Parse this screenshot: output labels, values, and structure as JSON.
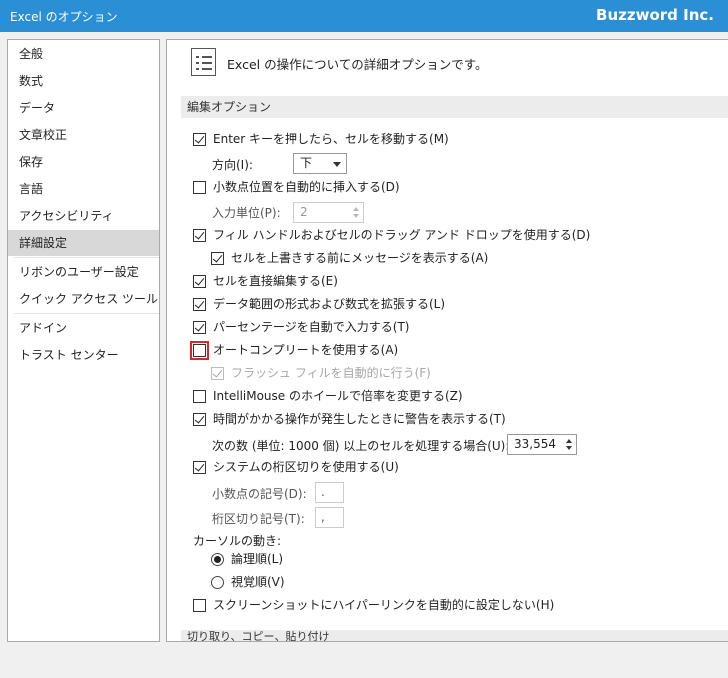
{
  "window": {
    "title": "Excel のオプション",
    "brand": "Buzzword Inc."
  },
  "sidebar": {
    "items": [
      {
        "label": "全般"
      },
      {
        "label": "数式"
      },
      {
        "label": "データ"
      },
      {
        "label": "文章校正"
      },
      {
        "label": "保存"
      },
      {
        "label": "言語"
      },
      {
        "label": "アクセシビリティ"
      },
      {
        "label": "詳細設定",
        "selected": true
      },
      {
        "label": "リボンのユーザー設定"
      },
      {
        "label": "クイック アクセス ツール バー"
      },
      {
        "label": "アドイン"
      },
      {
        "label": "トラスト センター"
      }
    ]
  },
  "main": {
    "header": "Excel の操作についての詳細オプションです。",
    "section_edit": "編集オプション",
    "section_next": "切り取り、コピー、貼り付け",
    "opt_enter_move": {
      "label": "Enter キーを押したら、セルを移動する(M)",
      "checked": true
    },
    "direction": {
      "label": "方向(I):",
      "value": "下"
    },
    "opt_auto_decimal": {
      "label": "小数点位置を自動的に挿入する(D)",
      "checked": false
    },
    "decimal_places": {
      "label": "入力単位(P):",
      "value": "2"
    },
    "opt_fill_handle": {
      "label": "フィル ハンドルおよびセルのドラッグ アンド ドロップを使用する(D)",
      "checked": true
    },
    "opt_overwrite_alert": {
      "label": "セルを上書きする前にメッセージを表示する(A)",
      "checked": true
    },
    "opt_edit_in_cell": {
      "label": "セルを直接編集する(E)",
      "checked": true
    },
    "opt_extend_formats": {
      "label": "データ範囲の形式および数式を拡張する(L)",
      "checked": true
    },
    "opt_auto_percent": {
      "label": "パーセンテージを自動で入力する(T)",
      "checked": true
    },
    "opt_autocomplete": {
      "label": "オートコンプリートを使用する(A)",
      "checked": false
    },
    "opt_flash_fill": {
      "label": "フラッシュ フィルを自動的に行う(F)",
      "checked": true,
      "disabled": true
    },
    "opt_intellimouse": {
      "label": "IntelliMouse のホイールで倍率を変更する(Z)",
      "checked": false
    },
    "opt_slow_alert": {
      "label": "時間がかかる操作が発生したときに警告を表示する(T)",
      "checked": true
    },
    "cells_threshold": {
      "label": "次の数 (単位: 1000 個) 以上のセルを処理する場合(U):",
      "value": "33,554"
    },
    "opt_system_separators": {
      "label": "システムの桁区切りを使用する(U)",
      "checked": true
    },
    "decimal_symbol": {
      "label": "小数点の記号(D):",
      "value": "."
    },
    "thousands_symbol": {
      "label": "桁区切り記号(T):",
      "value": ","
    },
    "cursor_movement": {
      "label": "カーソルの動き:",
      "logical": {
        "label": "論理順(L)",
        "selected": true
      },
      "visual": {
        "label": "視覚順(V)",
        "selected": false
      }
    },
    "opt_no_hyperlink": {
      "label": "スクリーンショットにハイパーリンクを自動的に設定しない(H)",
      "checked": false
    }
  },
  "colors": {
    "titlebar": "#2b8fd6",
    "highlight": "#d9262b",
    "selected_nav": "#d8d8d8"
  }
}
